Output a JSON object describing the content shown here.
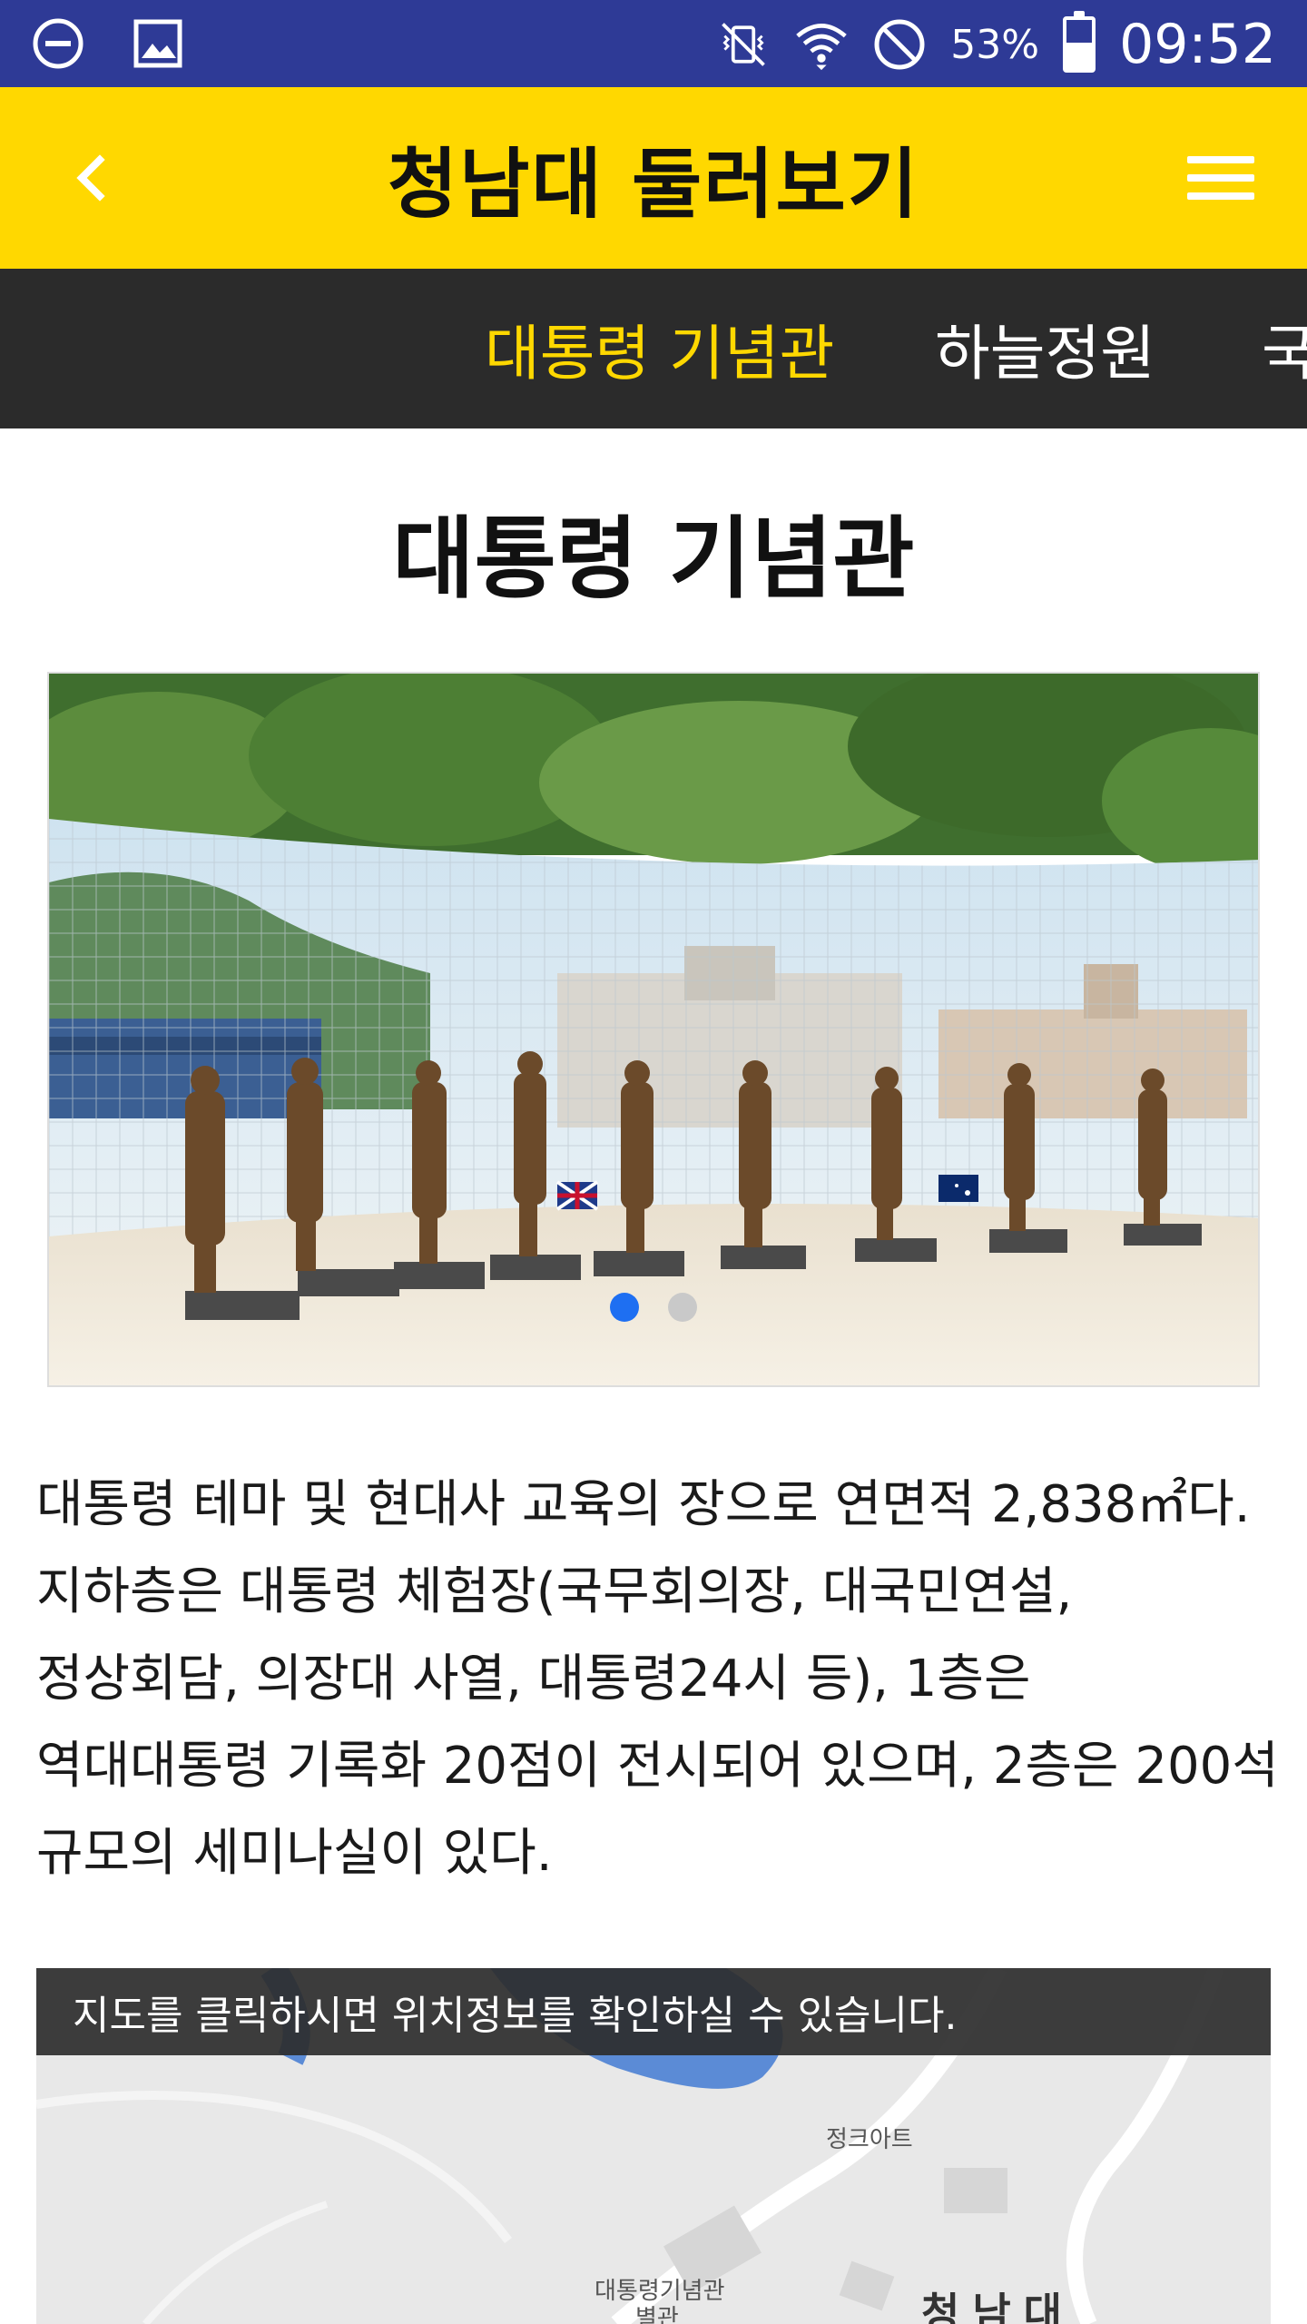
{
  "status_bar": {
    "battery_percent": "53%",
    "battery_level": 0.53,
    "time": "09:52",
    "bg_color": "#2e3a96",
    "icons": [
      "do-not-disturb-icon",
      "image-icon",
      "vibrate-mute-icon",
      "wifi-icon",
      "blocked-icon",
      "battery-icon"
    ]
  },
  "header": {
    "title": "청남대 둘러보기",
    "bg_color": "#ffd800",
    "back_icon": "chevron-left-icon",
    "menu_icon": "hamburger-menu-icon"
  },
  "tabs": {
    "items": [
      {
        "label": "대통령 기념관",
        "active": true
      },
      {
        "label": "하늘정원",
        "active": false
      },
      {
        "label": "국",
        "active": false
      }
    ],
    "active_color": "#ffd800"
  },
  "content": {
    "title": "대통령 기념관",
    "carousel": {
      "total": 2,
      "current": 1
    },
    "description": "대통령 테마 및 현대사 교육의 장으로 연면적 2,838㎡다. 지하층은 대통령 체험장(국무회의장, 대국민연설, 정상회담, 의장대 사열, 대통령24시 등), 1층은 역대대통령 기록화 20점이 전시되어 있으며, 2층은 200석 규모의 세미나실이 있다."
  },
  "map": {
    "banner": "지도를 클릭하시면 위치정보를 확인하실 수 있습니다.",
    "labels": {
      "place1": "정크아트",
      "place2": "대통령기념관",
      "place3": "별관",
      "area": "청남대"
    }
  }
}
